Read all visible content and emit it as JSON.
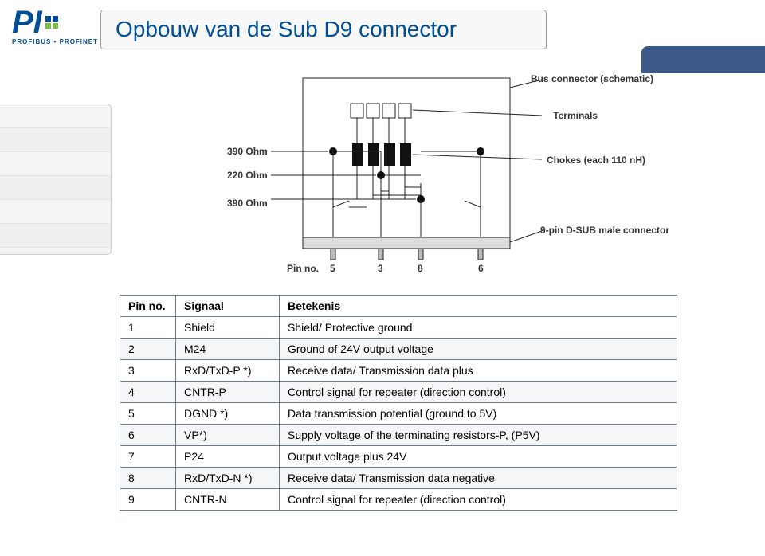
{
  "logo": {
    "letters": "PI",
    "subtext": "PROFIBUS • PROFINET"
  },
  "title": "Opbouw van de Sub D9 connector",
  "diagram": {
    "bus_connector": "Bus connector (schematic)",
    "terminals": "Terminals",
    "r1": "390 Ohm",
    "r2": "220 Ohm",
    "r3": "390 Ohm",
    "chokes": "Chokes (each 110 nH)",
    "connector": "9-pin D-SUB male connector",
    "pinno_label": "Pin no.",
    "pin5": "5",
    "pin3": "3",
    "pin8": "8",
    "pin6": "6"
  },
  "table": {
    "headers": {
      "pin": "Pin no.",
      "signal": "Signaal",
      "meaning": "Betekenis"
    },
    "rows": [
      {
        "pin": "1",
        "signal": "Shield",
        "meaning": "Shield/ Protective ground"
      },
      {
        "pin": "2",
        "signal": "M24",
        "meaning": "Ground of 24V output voltage"
      },
      {
        "pin": "3",
        "signal": "RxD/TxD-P *)",
        "meaning": "Receive data/ Transmission data plus"
      },
      {
        "pin": "4",
        "signal": "CNTR-P",
        "meaning": "Control signal for repeater (direction control)"
      },
      {
        "pin": "5",
        "signal": "DGND *)",
        "meaning": "Data transmission potential (ground to 5V)"
      },
      {
        "pin": "6",
        "signal": "VP*)",
        "meaning": "Supply voltage of the terminating resistors-P, (P5V)"
      },
      {
        "pin": "7",
        "signal": "P24",
        "meaning": "Output voltage plus 24V"
      },
      {
        "pin": "8",
        "signal": "RxD/TxD-N *)",
        "meaning": "Receive data/ Transmission data negative"
      },
      {
        "pin": "9",
        "signal": "CNTR-N",
        "meaning": "Control signal for repeater (direction control)"
      }
    ]
  }
}
